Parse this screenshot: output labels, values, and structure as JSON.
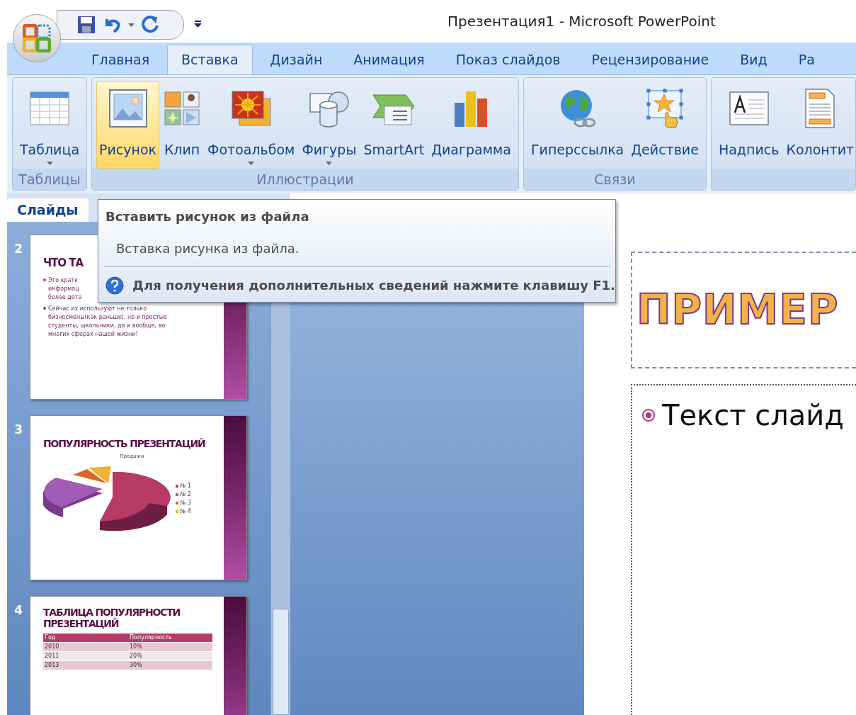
{
  "window": {
    "title": "Презентация1 - Microsoft PowerPoint"
  },
  "tabs": [
    {
      "label": "Главная",
      "selected": false
    },
    {
      "label": "Вставка",
      "selected": true
    },
    {
      "label": "Дизайн",
      "selected": false
    },
    {
      "label": "Анимация",
      "selected": false
    },
    {
      "label": "Показ слайдов",
      "selected": false
    },
    {
      "label": "Рецензирование",
      "selected": false
    },
    {
      "label": "Вид",
      "selected": false
    },
    {
      "label": "Ра",
      "selected": false
    }
  ],
  "ribbon_groups": [
    {
      "label": "Таблицы",
      "buttons": [
        {
          "kind": "table",
          "label": "Таблица",
          "dropdown": true,
          "highlighted": false
        }
      ]
    },
    {
      "label": "Иллюстрации",
      "buttons": [
        {
          "kind": "picture",
          "label": "Рисунок",
          "dropdown": false,
          "highlighted": true
        },
        {
          "kind": "clip",
          "label": "Клип",
          "dropdown": false,
          "highlighted": false
        },
        {
          "kind": "album",
          "label": "Фотоальбом",
          "dropdown": true,
          "highlighted": false
        },
        {
          "kind": "shapes",
          "label": "Фигуры",
          "dropdown": true,
          "highlighted": false
        },
        {
          "kind": "smartart",
          "label": "SmartArt",
          "dropdown": false,
          "highlighted": false
        },
        {
          "kind": "chart",
          "label": "Диаграмма",
          "dropdown": false,
          "highlighted": false
        }
      ]
    },
    {
      "label": "Связи",
      "buttons": [
        {
          "kind": "link",
          "label": "Гиперссылка",
          "dropdown": false,
          "highlighted": false
        },
        {
          "kind": "action",
          "label": "Действие",
          "dropdown": false,
          "highlighted": false
        }
      ]
    },
    {
      "buttons": [
        {
          "kind": "textbox",
          "label": "Надпись",
          "dropdown": false,
          "highlighted": false
        },
        {
          "kind": "header",
          "label": "Колонтит",
          "dropdown": false,
          "highlighted": false
        }
      ]
    }
  ],
  "slides_pane": {
    "tab": "Слайды",
    "thumbnails": [
      {
        "number": "2",
        "kind": "text",
        "title": "ЧТО ТА",
        "bullets": [
          [
            "Это кратк",
            "информац",
            "более дета"
          ],
          [
            "Сейчас  их используют не только",
            "бизнесмены(как раньше), но и простые",
            "студенты, школьники, да и вообще, во",
            "многих сферах нашей жизни!"
          ]
        ]
      },
      {
        "number": "3",
        "kind": "chart",
        "title": "ПОПУЛЯРНОСТЬ ПРЕЗЕНТАЦИЙ",
        "chart_title": "Продажи",
        "legend": [
          {
            "label": "№ 1",
            "color": "#b83a66"
          },
          {
            "label": "№ 2",
            "color": "#a35bb8"
          },
          {
            "label": "№ 3",
            "color": "#d9662b"
          },
          {
            "label": "№ 4",
            "color": "#f0b030"
          }
        ]
      },
      {
        "number": "4",
        "kind": "table",
        "title": "ТАБЛИЦА ПОПУЛЯРНОСТИ ПРЕЗЕНТАЦИЙ",
        "columns": [
          "Год",
          "Популярность"
        ],
        "rows": [
          [
            "2010",
            "10%"
          ],
          [
            "2011",
            "20%"
          ],
          [
            "2013",
            "30%"
          ]
        ]
      }
    ]
  },
  "tooltip": {
    "title": "Вставить рисунок из файла",
    "description": "Вставка рисунка из файла.",
    "help": "Для получения дополнительных сведений нажмите клавишу F1."
  },
  "slide": {
    "title": "ПРИМЕР",
    "body": "Текст слайд"
  }
}
